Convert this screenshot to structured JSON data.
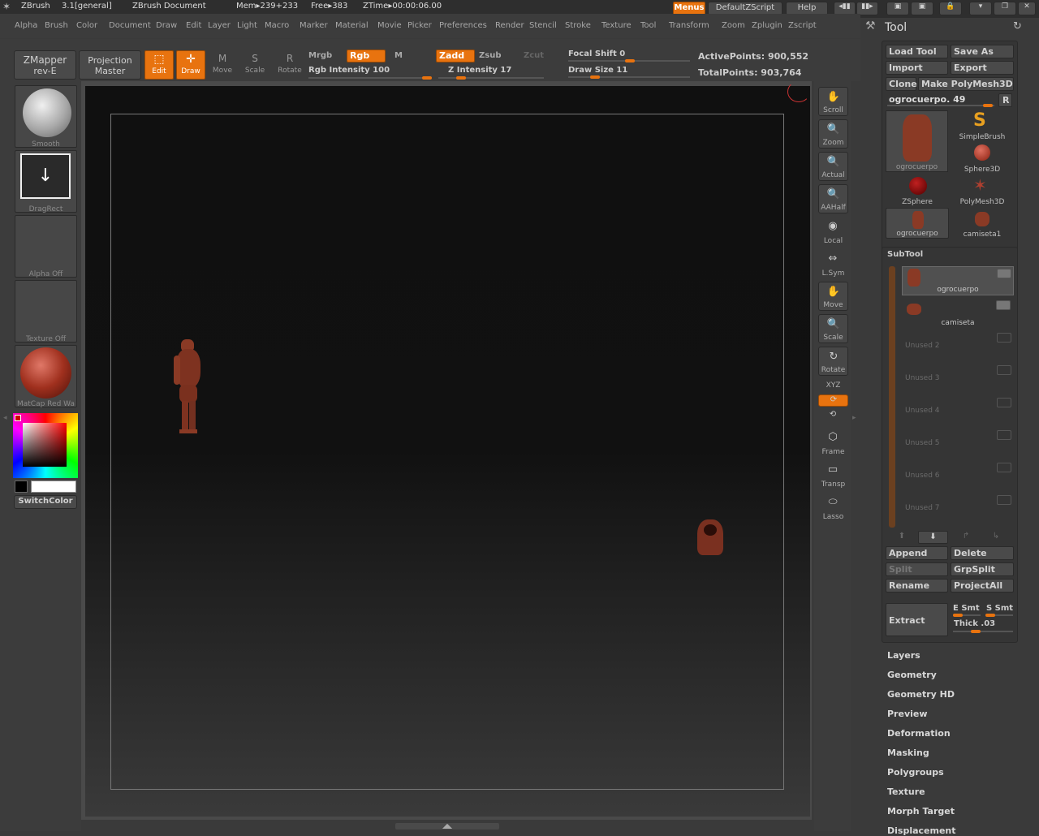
{
  "titlebar": {
    "app": "ZBrush",
    "version": "3.1[general]",
    "doc": "ZBrush Document",
    "mem": "Mem▸239+233",
    "free": "Free▸383",
    "ztime": "ZTime▸00:00:06.00",
    "menus_btn": "Menus",
    "script_btn": "DefaultZScript",
    "help_btn": "Help"
  },
  "menubar": [
    "Alpha",
    "Brush",
    "Color",
    "Document",
    "Draw",
    "Edit",
    "Layer",
    "Light",
    "Macro",
    "Marker",
    "Material",
    "Movie",
    "Picker",
    "Preferences",
    "Render",
    "Stencil",
    "Stroke",
    "Texture",
    "Tool",
    "Transform",
    "Zoom",
    "Zplugin",
    "Zscript"
  ],
  "top": {
    "zmapper": "ZMapper",
    "zmapper_sub": "rev-E",
    "projection": "Projection",
    "projection_sub": "Master",
    "edit": "Edit",
    "draw": "Draw",
    "move": "Move",
    "scale": "Scale",
    "rotate": "Rotate",
    "mrgb": "Mrgb",
    "rgb": "Rgb",
    "m": "M",
    "zadd": "Zadd",
    "zsub": "Zsub",
    "zcut": "Zcut",
    "rgb_intensity": "Rgb Intensity 100",
    "z_intensity": "Z Intensity 17",
    "focal_shift": "Focal Shift 0",
    "draw_size": "Draw Size 11",
    "active_points": "ActivePoints: 900,552",
    "total_points": "TotalPoints: 903,764"
  },
  "left": {
    "smooth": "Smooth",
    "dragrect": "DragRect",
    "alpha": "Alpha  Off",
    "texture": "Texture  Off",
    "matcap": "MatCap  Red  Wa",
    "switchcolor": "SwitchColor"
  },
  "right": [
    "Scroll",
    "Zoom",
    "Actual",
    "AAHalf",
    "Local",
    "L.Sym",
    "Move",
    "Scale",
    "Rotate",
    "XYZ",
    "",
    "",
    "Frame",
    "Transp",
    "Lasso"
  ],
  "tool": {
    "title": "Tool",
    "load": "Load Tool",
    "saveas": "Save As",
    "import": "Import",
    "export": "Export",
    "clone": "Clone",
    "make": "Make PolyMesh3D",
    "current": "ogrocuerpo. 49",
    "r": "R",
    "tiles": [
      "ogrocuerpo",
      "SimpleBrush",
      "Sphere3D",
      "ZSphere",
      "PolyMesh3D",
      "ogrocuerpo",
      "camiseta1"
    ]
  },
  "subtool": {
    "title": "SubTool",
    "items": [
      "ogrocuerpo",
      "camiseta"
    ],
    "unused": [
      "Unused  2",
      "Unused  3",
      "Unused  4",
      "Unused  5",
      "Unused  6",
      "Unused  7"
    ],
    "append": "Append",
    "delete": "Delete",
    "split": "Split",
    "grpsplit": "GrpSplit",
    "rename": "Rename",
    "projectall": "ProjectAll",
    "extract": "Extract",
    "esmt": "E Smt",
    "ssmt": "S Smt",
    "thick": "Thick .03"
  },
  "sections": [
    "Layers",
    "Geometry",
    "Geometry HD",
    "Preview",
    "Deformation",
    "Masking",
    "Polygroups",
    "Texture",
    "Morph Target",
    "Displacement"
  ],
  "colors": {
    "accent": "#e8730f",
    "figure": "#8a3a25"
  }
}
